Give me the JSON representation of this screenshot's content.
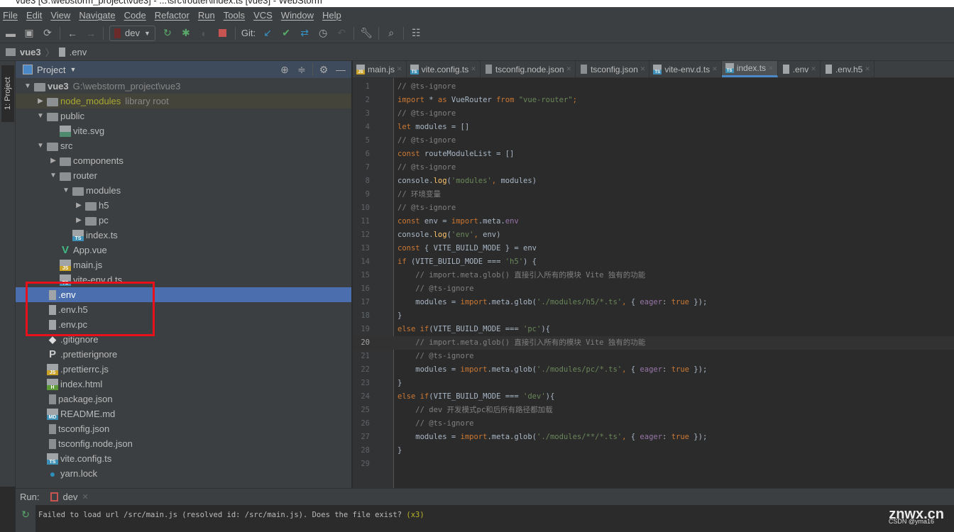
{
  "window": {
    "title": "vue3 [G:\\webstorm_project\\vue3] - ...\\src\\router\\index.ts [vue3] - WebStorm"
  },
  "menu": [
    "File",
    "Edit",
    "View",
    "Navigate",
    "Code",
    "Refactor",
    "Run",
    "Tools",
    "VCS",
    "Window",
    "Help"
  ],
  "toolbar": {
    "run_config": "dev",
    "git_label": "Git:",
    "icons": [
      "open-folder-icon",
      "save-icon",
      "sync-icon",
      "back-icon",
      "forward-icon",
      "run-config",
      "rerun-icon",
      "debug-icon",
      "coverage-icon",
      "stop-icon",
      "git-update-icon",
      "git-commit-icon",
      "git-push-icon",
      "history-icon",
      "revert-icon",
      "wrench-icon",
      "search-icon",
      "structure-icon"
    ]
  },
  "breadcrumb": [
    "vue3",
    ".env"
  ],
  "sidebar": {
    "strip_label": "1: Project",
    "panel_title": "Project"
  },
  "tree": [
    {
      "label": "vue3",
      "extra": "G:\\webstorm_project\\vue3",
      "level": 0,
      "type": "folder",
      "open": true,
      "bold": true
    },
    {
      "label": "node_modules",
      "extra": "library root",
      "level": 1,
      "type": "folder",
      "open": false,
      "color": "#a8a832",
      "hl": true
    },
    {
      "label": "public",
      "level": 1,
      "type": "folder",
      "open": true
    },
    {
      "label": "vite.svg",
      "level": 2,
      "type": "file",
      "icon": "svg"
    },
    {
      "label": "src",
      "level": 1,
      "type": "folder",
      "open": true
    },
    {
      "label": "components",
      "level": 2,
      "type": "folder",
      "open": false
    },
    {
      "label": "router",
      "level": 2,
      "type": "folder",
      "open": true
    },
    {
      "label": "modules",
      "level": 3,
      "type": "folder",
      "open": true
    },
    {
      "label": "h5",
      "level": 4,
      "type": "folder",
      "open": false
    },
    {
      "label": "pc",
      "level": 4,
      "type": "folder",
      "open": false
    },
    {
      "label": "index.ts",
      "level": 3,
      "type": "file",
      "icon": "TS"
    },
    {
      "label": "App.vue",
      "level": 2,
      "type": "file",
      "icon": "vue"
    },
    {
      "label": "main.js",
      "level": 2,
      "type": "file",
      "icon": "JS"
    },
    {
      "label": "vite-env.d.ts",
      "level": 2,
      "type": "file",
      "icon": "TS"
    },
    {
      "label": ".env",
      "level": 1,
      "type": "file",
      "icon": "text",
      "selected": true
    },
    {
      "label": ".env.h5",
      "level": 1,
      "type": "file",
      "icon": "text"
    },
    {
      "label": ".env.pc",
      "level": 1,
      "type": "file",
      "icon": "text"
    },
    {
      "label": ".gitignore",
      "level": 1,
      "type": "file",
      "icon": "git"
    },
    {
      "label": ".prettierignore",
      "level": 1,
      "type": "file",
      "icon": "P"
    },
    {
      "label": ".prettierrc.js",
      "level": 1,
      "type": "file",
      "icon": "JS"
    },
    {
      "label": "index.html",
      "level": 1,
      "type": "file",
      "icon": "H"
    },
    {
      "label": "package.json",
      "level": 1,
      "type": "file",
      "icon": "json"
    },
    {
      "label": "README.md",
      "level": 1,
      "type": "file",
      "icon": "MD"
    },
    {
      "label": "tsconfig.json",
      "level": 1,
      "type": "file",
      "icon": "json"
    },
    {
      "label": "tsconfig.node.json",
      "level": 1,
      "type": "file",
      "icon": "json"
    },
    {
      "label": "vite.config.ts",
      "level": 1,
      "type": "file",
      "icon": "TS"
    },
    {
      "label": "yarn.lock",
      "level": 1,
      "type": "file",
      "icon": "yarn"
    }
  ],
  "tabs": [
    {
      "label": "main.js",
      "icon": "JS"
    },
    {
      "label": "vite.config.ts",
      "icon": "TS"
    },
    {
      "label": "tsconfig.node.json",
      "icon": "json"
    },
    {
      "label": "tsconfig.json",
      "icon": "json"
    },
    {
      "label": "vite-env.d.ts",
      "icon": "TS"
    },
    {
      "label": "index.ts",
      "icon": "TS",
      "active": true
    },
    {
      "label": ".env",
      "icon": "text"
    },
    {
      "label": ".env.h5",
      "icon": "text"
    }
  ],
  "editor": {
    "current_line": 20,
    "lines": [
      [
        [
          "c",
          "// @ts-ignore"
        ]
      ],
      [
        [
          "k",
          "import"
        ],
        [
          "p",
          " * "
        ],
        [
          "k",
          "as"
        ],
        [
          "p",
          " VueRouter "
        ],
        [
          "k",
          "from"
        ],
        [
          "s",
          " \"vue-router\""
        ],
        [
          "k",
          ";"
        ]
      ],
      [
        [
          "c",
          "// @ts-ignore"
        ]
      ],
      [
        [
          "k",
          "let"
        ],
        [
          "p",
          " modules = []"
        ]
      ],
      [
        [
          "c",
          "// @ts-ignore"
        ]
      ],
      [
        [
          "k",
          "const"
        ],
        [
          "p",
          " routeModuleList = []"
        ]
      ],
      [
        [
          "c",
          "// @ts-ignore"
        ]
      ],
      [
        [
          "p",
          "console."
        ],
        [
          "f",
          "log"
        ],
        [
          "p",
          "("
        ],
        [
          "s",
          "'modules'"
        ],
        [
          "k",
          ", "
        ],
        [
          "p",
          "modules)"
        ]
      ],
      [
        [
          "c",
          "// 环境变量"
        ]
      ],
      [
        [
          "c",
          "// @ts-ignore"
        ]
      ],
      [
        [
          "k",
          "const"
        ],
        [
          "p",
          " env = "
        ],
        [
          "k",
          "import"
        ],
        [
          "p",
          ".meta."
        ],
        [
          "m",
          "env"
        ]
      ],
      [
        [
          "p",
          "console."
        ],
        [
          "f",
          "log"
        ],
        [
          "p",
          "("
        ],
        [
          "s",
          "'env'"
        ],
        [
          "k",
          ", "
        ],
        [
          "p",
          "env)"
        ]
      ],
      [
        [
          "k",
          "const"
        ],
        [
          "p",
          " { VITE_BUILD_MODE } = env"
        ]
      ],
      [
        [
          "k",
          "if"
        ],
        [
          "p",
          " (VITE_BUILD_MODE === "
        ],
        [
          "s",
          "'h5'"
        ],
        [
          "p",
          ") {"
        ]
      ],
      [
        [
          "c",
          "    // import.meta.glob() 直接引入所有的模块 Vite 独有的功能"
        ]
      ],
      [
        [
          "c",
          "    // @ts-ignore"
        ]
      ],
      [
        [
          "p",
          "    modules = "
        ],
        [
          "k",
          "import"
        ],
        [
          "p",
          ".meta.glob("
        ],
        [
          "s",
          "'./modules/h5/*.ts'"
        ],
        [
          "k",
          ", "
        ],
        [
          "p",
          "{ "
        ],
        [
          "m",
          "eager"
        ],
        [
          "p",
          ": "
        ],
        [
          "k",
          "true"
        ],
        [
          "p",
          " });"
        ]
      ],
      [
        [
          "p",
          "}"
        ]
      ],
      [
        [
          "k",
          "else if"
        ],
        [
          "p",
          "(VITE_BUILD_MODE === "
        ],
        [
          "s",
          "'pc'"
        ],
        [
          "p",
          "){"
        ]
      ],
      [
        [
          "c",
          "    // import.meta.glob() 直接引入所有的模块 Vite 独有的功能"
        ]
      ],
      [
        [
          "c",
          "    // @ts-ignore"
        ]
      ],
      [
        [
          "p",
          "    modules = "
        ],
        [
          "k",
          "import"
        ],
        [
          "p",
          ".meta.glob("
        ],
        [
          "s",
          "'./modules/pc/*.ts'"
        ],
        [
          "k",
          ", "
        ],
        [
          "p",
          "{ "
        ],
        [
          "m",
          "eager"
        ],
        [
          "p",
          ": "
        ],
        [
          "k",
          "true"
        ],
        [
          "p",
          " });"
        ]
      ],
      [
        [
          "p",
          "}"
        ]
      ],
      [
        [
          "k",
          "else if"
        ],
        [
          "p",
          "(VITE_BUILD_MODE === "
        ],
        [
          "s",
          "'dev'"
        ],
        [
          "p",
          "){"
        ]
      ],
      [
        [
          "c",
          "    // dev 开发模式pc和后所有路径都加载"
        ]
      ],
      [
        [
          "c",
          "    // @ts-ignore"
        ]
      ],
      [
        [
          "p",
          "    modules = "
        ],
        [
          "k",
          "import"
        ],
        [
          "p",
          ".meta.glob("
        ],
        [
          "s",
          "'./modules/**/*.ts'"
        ],
        [
          "k",
          ", "
        ],
        [
          "p",
          "{ "
        ],
        [
          "m",
          "eager"
        ],
        [
          "p",
          ": "
        ],
        [
          "k",
          "true"
        ],
        [
          "p",
          " });"
        ]
      ],
      [
        [
          "p",
          "}"
        ]
      ],
      []
    ]
  },
  "run": {
    "label": "Run:",
    "tab": "dev",
    "message": "Failed to load url /src/main.js (resolved id: /src/main.js). Does the file exist? ",
    "count": "(x3)"
  },
  "watermark": {
    "site": "znwx.cn",
    "credit": "CSDN @yma16"
  },
  "colors": {
    "selection": "#4b6eaf",
    "highlight_box": "#e8101a",
    "keyword": "#cc7832",
    "string": "#6a8759"
  }
}
